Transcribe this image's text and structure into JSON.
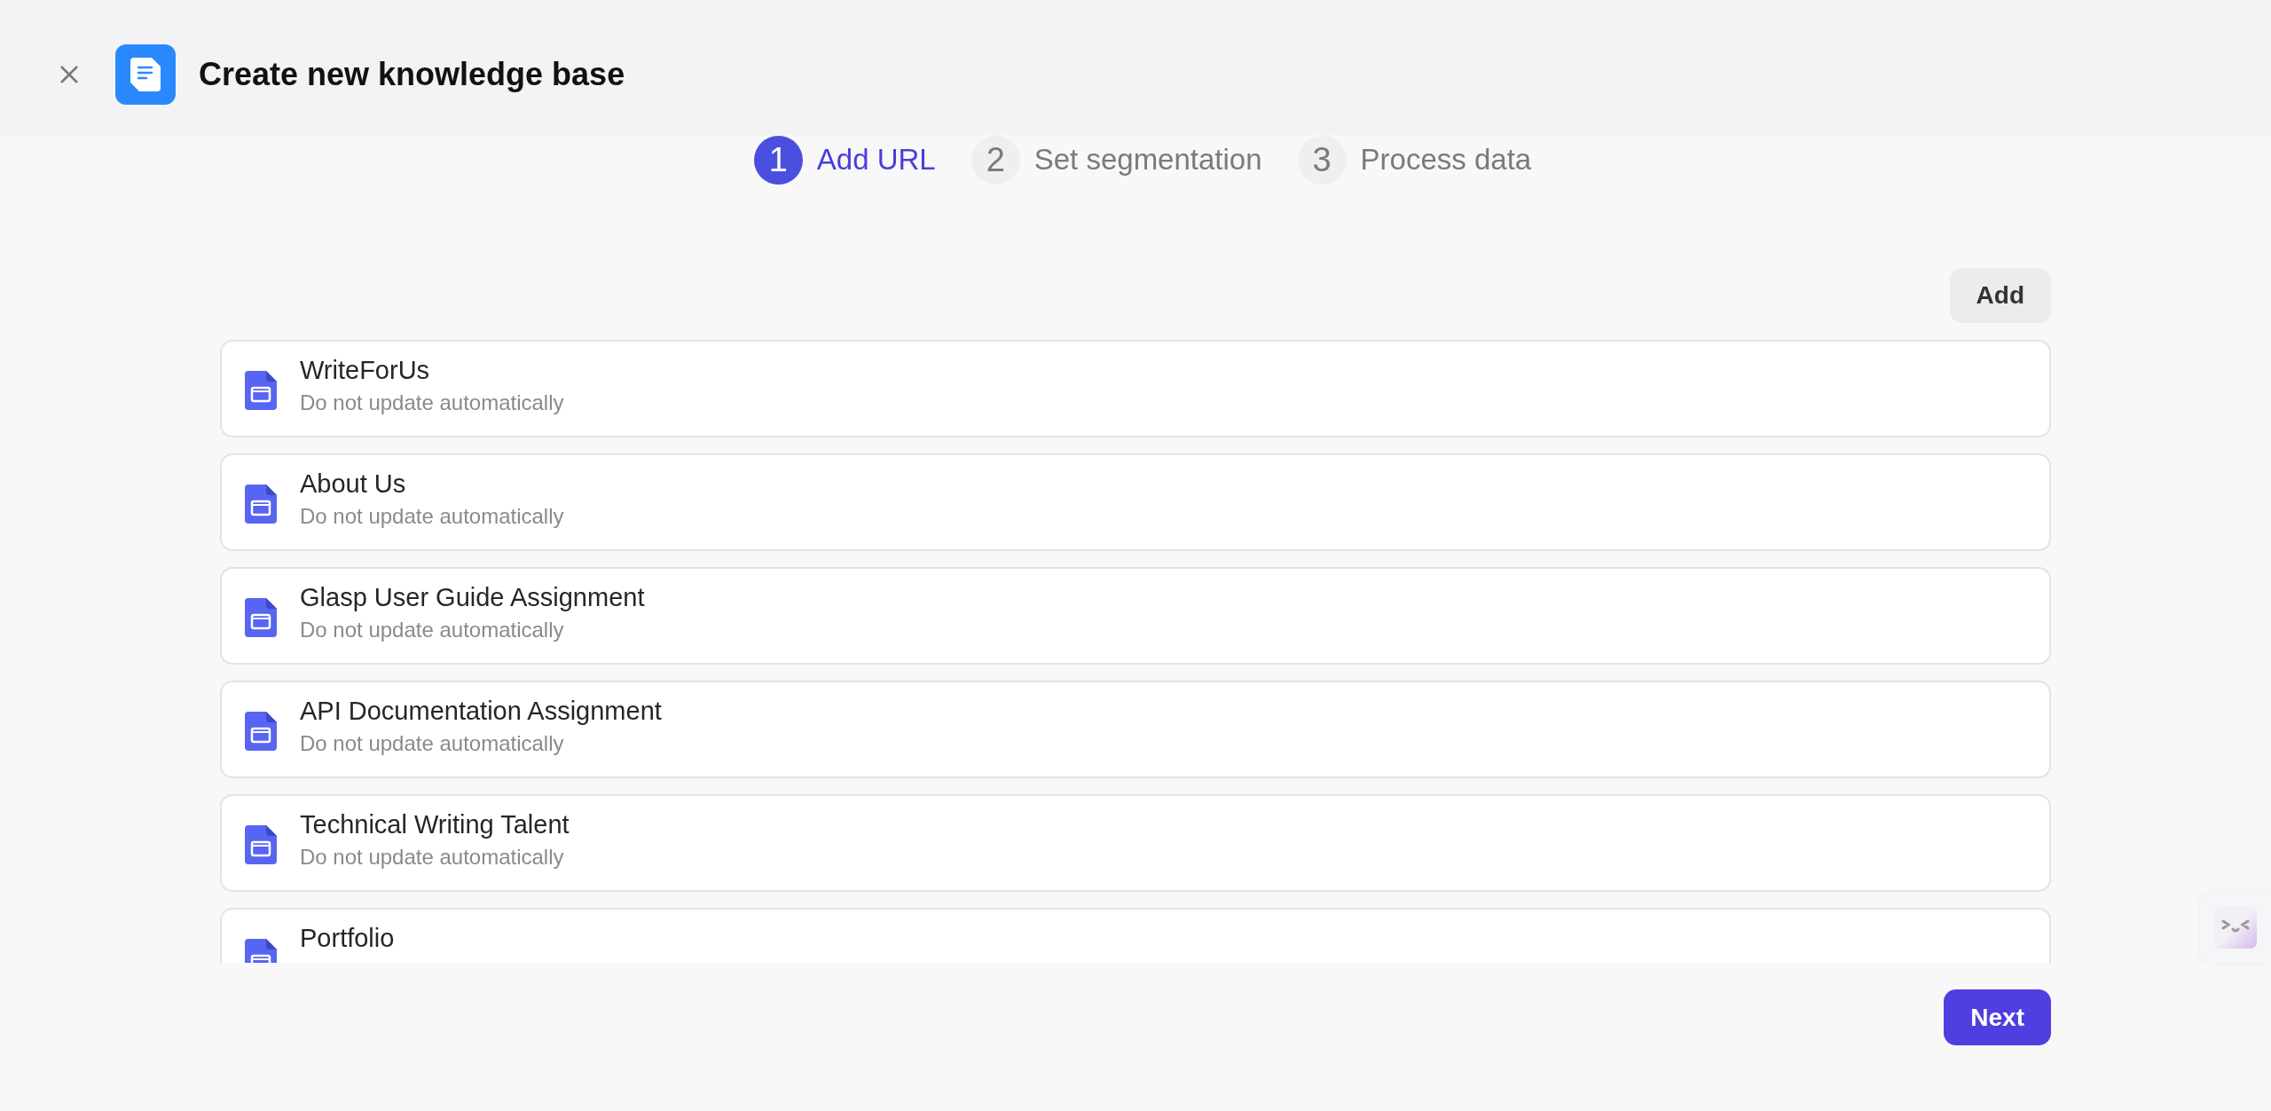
{
  "header": {
    "title": "Create new knowledge base"
  },
  "steps": [
    {
      "number": "1",
      "label": "Add URL",
      "selected": true
    },
    {
      "number": "2",
      "label": "Set segmentation",
      "selected": false
    },
    {
      "number": "3",
      "label": "Process data",
      "selected": false
    }
  ],
  "add_button": "Add",
  "sources": [
    {
      "title": "WriteForUs",
      "subtitle": "Do not update automatically"
    },
    {
      "title": "About Us",
      "subtitle": "Do not update automatically"
    },
    {
      "title": "Glasp User Guide Assignment",
      "subtitle": "Do not update automatically"
    },
    {
      "title": "API Documentation Assignment",
      "subtitle": "Do not update automatically"
    },
    {
      "title": "Technical Writing Talent",
      "subtitle": "Do not update automatically"
    },
    {
      "title": "Portfolio"
    }
  ],
  "next_button": "Next"
}
